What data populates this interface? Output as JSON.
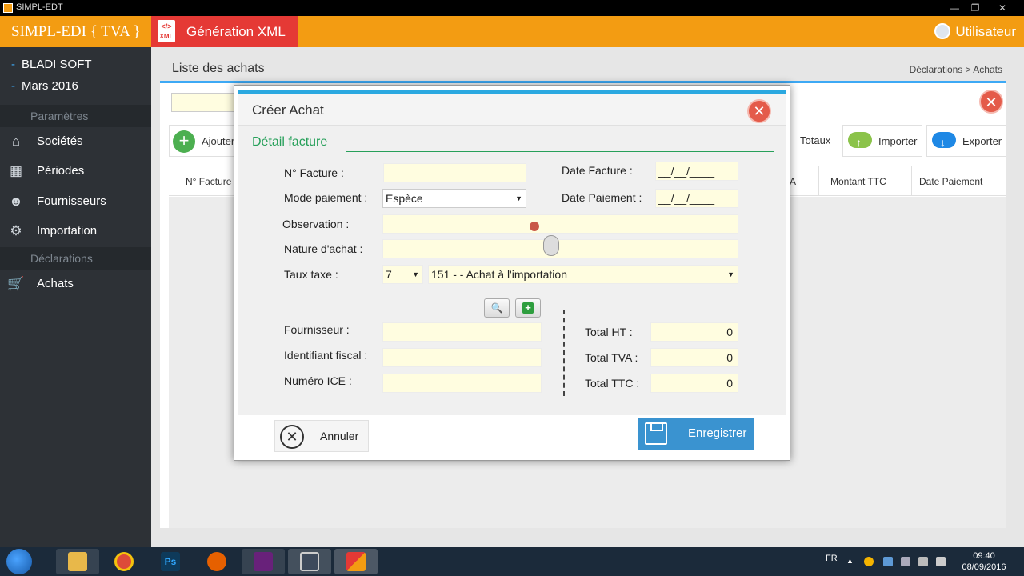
{
  "window": {
    "title": "SIMPL-EDT",
    "controls": [
      "—",
      "❐",
      "✕"
    ]
  },
  "header": {
    "brand": "SIMPL-EDI { TVA }",
    "gen_xml_label": "Génération XML",
    "gen_xml_icon_text": "XML",
    "user_label": "Utilisateur",
    "colors": {
      "header": "#f39c12",
      "gen_xml": "#e53935"
    }
  },
  "sidebar": {
    "company": "BLADI SOFT",
    "period": "Mars 2016",
    "sections": {
      "params": "Paramètres",
      "declarations": "Déclarations"
    },
    "items": [
      {
        "label": "Sociétés",
        "icon": "building-icon"
      },
      {
        "label": "Périodes",
        "icon": "calendar-icon"
      },
      {
        "label": "Fournisseurs",
        "icon": "people-icon"
      },
      {
        "label": "Importation",
        "icon": "gear-icon"
      },
      {
        "label": "Achats",
        "icon": "cart-icon"
      }
    ]
  },
  "page": {
    "title": "Liste des achats",
    "breadcrumb": "Déclarations > Achats",
    "toolbar": {
      "ajouter": "Ajouter",
      "totaux": "Totaux",
      "importer": "Importer",
      "exporter": "Exporter"
    },
    "columns": {
      "n_facture": "N° Facture",
      "tva_partial": "A",
      "montant_ttc": "Montant TTC",
      "date_paiement": "Date Paiement"
    }
  },
  "modal": {
    "title": "Créer Achat",
    "section": "Détail facture",
    "labels": {
      "n_facture": "N° Facture :",
      "mode_paiement": "Mode paiement :",
      "observation": "Observation :",
      "nature_achat": "Nature d'achat :",
      "taux_taxe": "Taux taxe :",
      "date_facture": "Date Facture :",
      "date_paiement": "Date Paiement :",
      "fournisseur": "Fournisseur :",
      "identifiant_fiscal": "Identifiant fiscal :",
      "numero_ice": "Numéro ICE :",
      "total_ht": "Total HT :",
      "total_tva": "Total TVA :",
      "total_ttc": "Total TTC :"
    },
    "values": {
      "n_facture": "",
      "mode_paiement": "Espèce",
      "observation": "",
      "nature_achat": "",
      "taux_taxe": "7",
      "taux_category": "151 - - Achat à l'importation",
      "date_facture": "__/__/____",
      "date_paiement": "__/__/____",
      "fournisseur": "",
      "identifiant_fiscal": "",
      "numero_ice": "",
      "total_ht": "0",
      "total_tva": "0",
      "total_ttc": "0"
    },
    "buttons": {
      "annuler": "Annuler",
      "enregistrer": "Enregistrer"
    }
  },
  "taskbar": {
    "apps": [
      "explorer-icon",
      "chrome-icon",
      "photoshop-icon",
      "firefox-icon",
      "visual-studio-icon",
      "floppy-icon",
      "app-icon"
    ],
    "ps_text": "Ps",
    "lang": "FR",
    "time": "09:40",
    "date": "08/09/2016"
  }
}
